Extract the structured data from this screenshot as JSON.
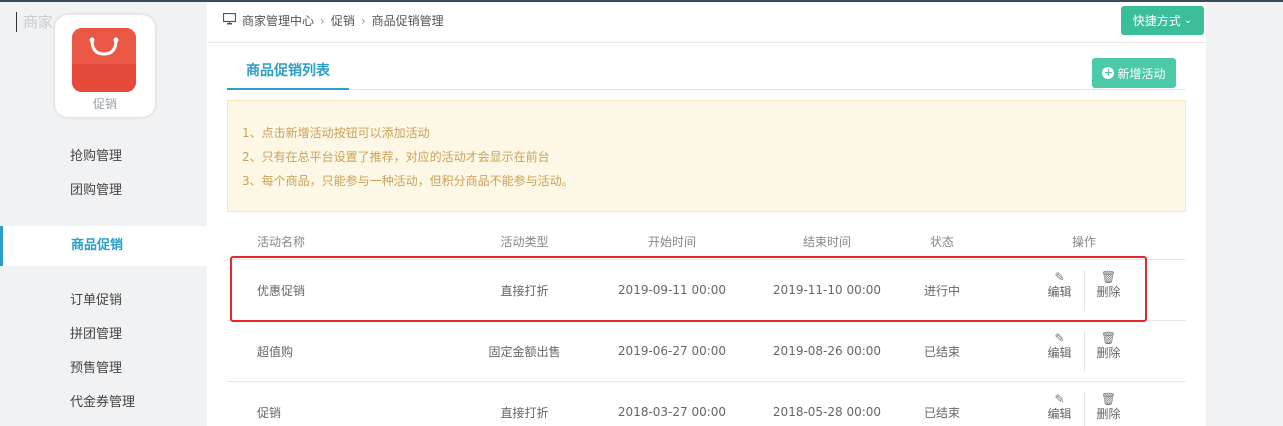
{
  "brand_fragment": "商家",
  "sidebar": {
    "logo_label": "促销",
    "items": [
      {
        "label": "抢购管理",
        "active": false
      },
      {
        "label": "团购管理",
        "active": false
      },
      {
        "label": "商品促销",
        "active": true
      },
      {
        "label": "订单促销",
        "active": false
      },
      {
        "label": "拼团管理",
        "active": false
      },
      {
        "label": "预售管理",
        "active": false
      },
      {
        "label": "代金券管理",
        "active": false
      }
    ]
  },
  "breadcrumb": [
    "商家管理中心",
    "促销",
    "商品促销管理"
  ],
  "header": {
    "quick_label": "快捷方式"
  },
  "tabs": [
    {
      "label": "商品促销列表",
      "active": true
    }
  ],
  "add_button": {
    "label": "新增活动"
  },
  "notice": [
    "1、点击新增活动按钮可以添加活动",
    "2、只有在总平台设置了推荐，对应的活动才会显示在前台",
    "3、每个商品，只能参与一种活动，但积分商品不能参与活动。"
  ],
  "table": {
    "headers": [
      "活动名称",
      "活动类型",
      "开始时间",
      "结束时间",
      "状态",
      "操作"
    ],
    "rows": [
      {
        "name": "优惠促销",
        "type": "直接打折",
        "start": "2019-09-11 00:00",
        "end": "2019-11-10 00:00",
        "status": "进行中",
        "edit": "编辑",
        "delete": "删除"
      },
      {
        "name": "超值购",
        "type": "固定金额出售",
        "start": "2019-06-27 00:00",
        "end": "2019-08-26 00:00",
        "status": "已结束",
        "edit": "编辑",
        "delete": "删除"
      },
      {
        "name": "促销",
        "type": "直接打折",
        "start": "2018-03-27 00:00",
        "end": "2018-05-28 00:00",
        "status": "已结束",
        "edit": "编辑",
        "delete": "删除"
      }
    ]
  },
  "colors": {
    "accent": "#2b9fc8",
    "add_button": "#4cc9a9",
    "quick_button": "#3bbf9b",
    "highlight": "#e8262a"
  }
}
